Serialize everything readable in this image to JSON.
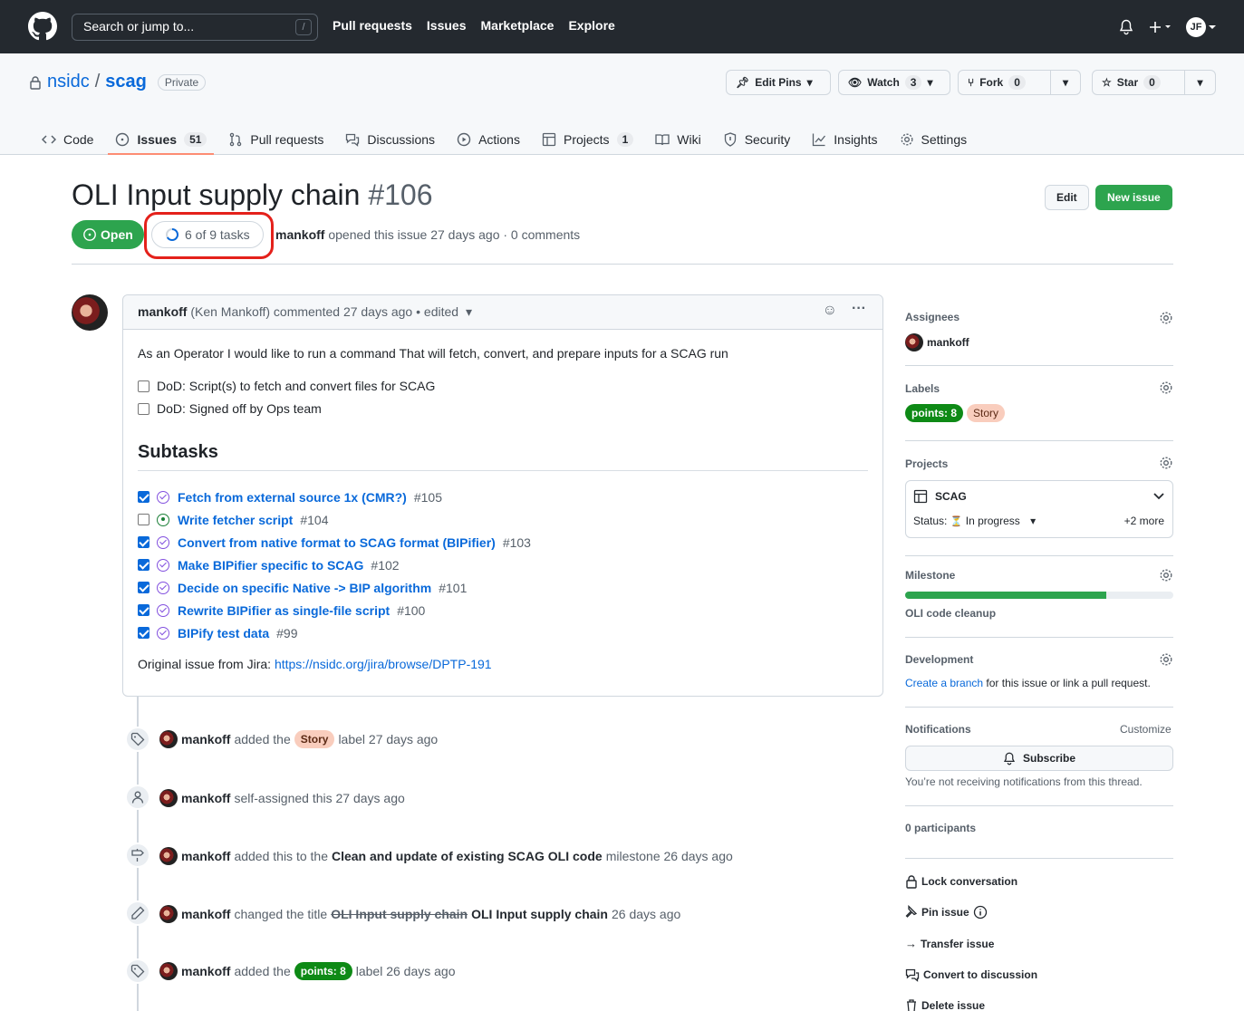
{
  "header": {
    "search_placeholder": "Search or jump to...",
    "search_key": "/",
    "nav": [
      "Pull requests",
      "Issues",
      "Marketplace",
      "Explore"
    ],
    "avatar_initials": "JF"
  },
  "repo": {
    "owner": "nsidc",
    "separator": "/",
    "name": "scag",
    "visibility": "Private",
    "edit_pins": "Edit Pins",
    "watch": "Watch",
    "watch_count": "3",
    "fork": "Fork",
    "fork_count": "0",
    "star": "Star",
    "star_count": "0"
  },
  "tabs": [
    {
      "label": "Code",
      "icon": "code-icon"
    },
    {
      "label": "Issues",
      "icon": "issue-icon",
      "count": "51"
    },
    {
      "label": "Pull requests",
      "icon": "pull-request-icon"
    },
    {
      "label": "Discussions",
      "icon": "discussions-icon"
    },
    {
      "label": "Actions",
      "icon": "play-icon"
    },
    {
      "label": "Projects",
      "icon": "table-icon",
      "count": "1"
    },
    {
      "label": "Wiki",
      "icon": "book-icon"
    },
    {
      "label": "Security",
      "icon": "shield-icon"
    },
    {
      "label": "Insights",
      "icon": "graph-icon"
    },
    {
      "label": "Settings",
      "icon": "gear-icon"
    }
  ],
  "issue": {
    "title": "OLI Input supply chain",
    "number": "#106",
    "state": "Open",
    "tasks": "6 of 9 tasks",
    "tasks_done": 6,
    "tasks_total": 9,
    "author": "mankoff",
    "meta_rest": "opened this issue 27 days ago · 0 comments",
    "edit_label": "Edit",
    "new_label": "New issue"
  },
  "comment": {
    "author": "mankoff",
    "header_rest": "(Ken Mankoff) commented 27 days ago • edited",
    "intro": "As an Operator I would like to run a command That will fetch, convert, and prepare inputs for a SCAG run",
    "dod": [
      "DoD: Script(s) to fetch and convert files for SCAG",
      "DoD: Signed off by Ops team"
    ],
    "subtasks_heading": "Subtasks",
    "subtasks": [
      {
        "title": "Fetch from external source 1x (CMR?)",
        "num": "#105",
        "checked": true,
        "state": "closed"
      },
      {
        "title": "Write fetcher script",
        "num": "#104",
        "checked": false,
        "state": "open"
      },
      {
        "title": "Convert from native format to SCAG format (BIPifier)",
        "num": "#103",
        "checked": true,
        "state": "closed"
      },
      {
        "title": "Make BIPifier specific to SCAG",
        "num": "#102",
        "checked": true,
        "state": "closed"
      },
      {
        "title": "Decide on specific Native -> BIP algorithm",
        "num": "#101",
        "checked": true,
        "state": "closed"
      },
      {
        "title": "Rewrite BIPifier as single-file script",
        "num": "#100",
        "checked": true,
        "state": "closed"
      },
      {
        "title": "BIPify test data",
        "num": "#99",
        "checked": true,
        "state": "closed"
      }
    ],
    "original_prefix": "Original issue from Jira: ",
    "original_link": "https://nsidc.org/jira/browse/DPTP-191"
  },
  "timeline": [
    {
      "icon": "tag-icon",
      "actor": "mankoff",
      "pre": "added the",
      "label": "Story",
      "label_kind": "story",
      "post": "label 27 days ago"
    },
    {
      "icon": "person-icon",
      "actor": "mankoff",
      "pre": "self-assigned this 27 days ago"
    },
    {
      "icon": "milestone-icon",
      "actor": "mankoff",
      "pre": "added this to the",
      "bold": "Clean and update of existing SCAG OLI code",
      "post": "milestone 26 days ago"
    },
    {
      "icon": "pencil-icon",
      "actor": "mankoff",
      "pre": "changed the title",
      "old": "OLI Input supply chain",
      "new": "OLI Input supply chain",
      "post": "26 days ago"
    },
    {
      "icon": "tag-icon",
      "actor": "mankoff",
      "pre": "added the",
      "label": "points: 8",
      "label_kind": "points",
      "post": "label 26 days ago"
    }
  ],
  "sidebar": {
    "assignees_h": "Assignees",
    "assignee": "mankoff",
    "labels_h": "Labels",
    "labels": [
      "points: 8",
      "Story"
    ],
    "projects_h": "Projects",
    "project_name": "SCAG",
    "status_label": "Status:",
    "status_value": "In progress",
    "more": "+2 more",
    "milestone_h": "Milestone",
    "milestone_name": "OLI code cleanup",
    "milestone_progress": 0.75,
    "development_h": "Development",
    "dev_link": "Create a branch",
    "dev_rest": " for this issue or link a pull request.",
    "notifications_h": "Notifications",
    "customize": "Customize",
    "subscribe": "Subscribe",
    "notif_note": "You’re not receiving notifications from this thread.",
    "participants": "0 participants",
    "actions": [
      {
        "label": "Lock conversation",
        "icon": "lock-icon"
      },
      {
        "label": "Pin issue",
        "icon": "pin-icon"
      },
      {
        "label": "Transfer issue",
        "icon": "arrow-right-icon"
      },
      {
        "label": "Convert to discussion",
        "icon": "comment-discussion-icon"
      },
      {
        "label": "Delete issue",
        "icon": "trash-icon"
      }
    ]
  }
}
